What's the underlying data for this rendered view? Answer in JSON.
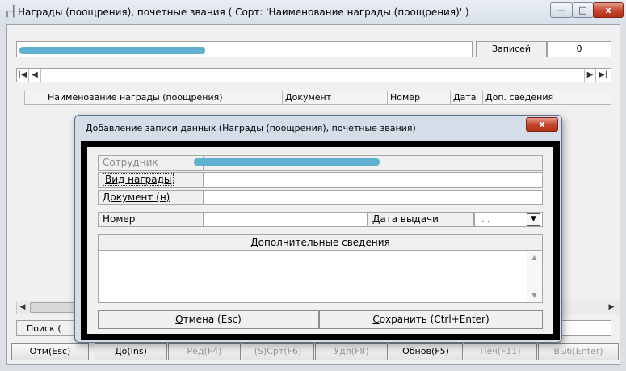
{
  "window": {
    "title": "Награды (поощрения), почетные звания ( Сорт: 'Наименование награды (поощрения)' )",
    "icon": "table-icon",
    "min_glyph": "—",
    "max_glyph": "□",
    "close_glyph": "x"
  },
  "info": {
    "records_label": "Записей",
    "records_value": "0"
  },
  "nav": {
    "first": "|◀",
    "prev": "◀",
    "next": "▶",
    "last": "▶|"
  },
  "columns": [
    "Наименование награды (поощрения)",
    "Документ",
    "Номер",
    "Дата",
    "Доп. сведения"
  ],
  "search": {
    "label": "Поиск ("
  },
  "scroll": {
    "left": "◀",
    "right": "▶"
  },
  "bottom_buttons": [
    {
      "label": "Отм(Esc)",
      "enabled": true
    },
    {
      "label": "До(Ins)",
      "enabled": true
    },
    {
      "label": "Ред(F4)",
      "enabled": false
    },
    {
      "label": "(S)Срт(F6)",
      "enabled": false
    },
    {
      "label": "Удл(F8)",
      "enabled": false
    },
    {
      "label": "Обнов(F5)",
      "enabled": true
    },
    {
      "label": "Печ(F11)",
      "enabled": false
    },
    {
      "label": "Выб(Enter)",
      "enabled": false
    }
  ],
  "dialog": {
    "title": "Добавление записи данных  (Награды (поощрения), почетные звания)",
    "close_glyph": "x",
    "employee_label": "Сотрудник",
    "award_type_label": "Вид награды",
    "document_label": "Документ    (н)",
    "number_label": "Номер",
    "issue_date_label": "Дата выдачи",
    "issue_date_value": ". .",
    "dropdown_glyph": "▼",
    "extra_label": "Дополнительные сведения",
    "memo_up": "▲",
    "memo_down": "▼",
    "cancel": {
      "hotkey": "О",
      "rest": "тмена (Esc)"
    },
    "save": {
      "hotkey": "С",
      "rest": "охранить (Ctrl+Enter)"
    }
  },
  "colors": {
    "accent_redaction": "#5fb2cf",
    "close_red": "#c4432b"
  }
}
